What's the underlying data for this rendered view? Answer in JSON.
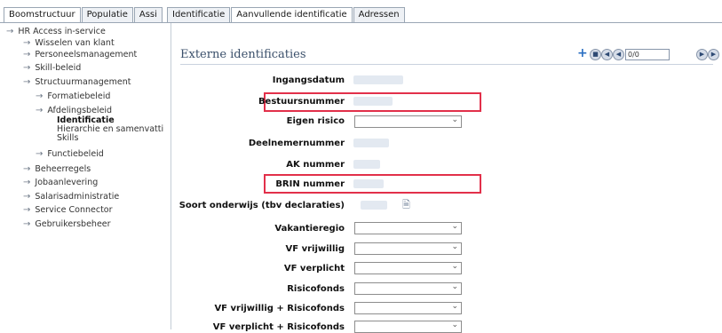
{
  "tabs_left": [
    {
      "label": "Boomstructuur",
      "active": true
    },
    {
      "label": "Populatie",
      "active": false
    },
    {
      "label": "Assi",
      "active": false
    }
  ],
  "tabs_right": [
    {
      "label": "Identificatie",
      "active": false
    },
    {
      "label": "Aanvullende identificatie",
      "active": true
    },
    {
      "label": "Adressen",
      "active": false
    }
  ],
  "sidebar": {
    "items": [
      {
        "label": "HR Access in-service"
      },
      {
        "label": "Wisselen van klant"
      },
      {
        "label": "Personeelsmanagement"
      },
      {
        "label": "Skill-beleid"
      },
      {
        "label": "Structuurmanagement"
      },
      {
        "label": "Formatiebeleid"
      },
      {
        "label": "Afdelingsbeleid"
      },
      {
        "label": "Identificatie"
      },
      {
        "label": "Hierarchie en samenvatti"
      },
      {
        "label": "Skills"
      },
      {
        "label": "Functiebeleid"
      },
      {
        "label": "Beheerregels"
      },
      {
        "label": "Jobaanlevering"
      },
      {
        "label": "Salarisadministratie"
      },
      {
        "label": "Service Connector"
      },
      {
        "label": "Gebruikersbeheer"
      }
    ]
  },
  "main": {
    "title": "Externe identificaties",
    "pager": {
      "value": "0/0",
      "icons": [
        "plus-icon",
        "delete-icon",
        "first-page-icon",
        "previous-page-icon",
        "next-page-icon",
        "last-page-icon"
      ]
    },
    "fields": [
      {
        "label": "Ingangsdatum",
        "type": "value"
      },
      {
        "label": "Bestuursnummer",
        "type": "value",
        "highlighted": true
      },
      {
        "label": "Eigen risico",
        "type": "select"
      },
      {
        "label": "Deelnemernummer",
        "type": "value"
      },
      {
        "label": "AK nummer",
        "type": "value"
      },
      {
        "label": "BRIN nummer",
        "type": "value",
        "highlighted": true
      },
      {
        "label": "Soort onderwijs (tbv declaraties)",
        "type": "value"
      },
      {
        "label": "Vakantieregio",
        "type": "select"
      },
      {
        "label": "VF vrijwillig",
        "type": "select"
      },
      {
        "label": "VF verplicht",
        "type": "select"
      },
      {
        "label": "Risicofonds",
        "type": "select"
      },
      {
        "label": "VF vrijwillig + Risicofonds",
        "type": "select"
      },
      {
        "label": "VF verplicht + Risicofonds",
        "type": "select"
      }
    ]
  },
  "colors": {
    "highlight": "#e2304a",
    "title": "#3a4f6a",
    "tab_border": "#9aa6b4"
  }
}
